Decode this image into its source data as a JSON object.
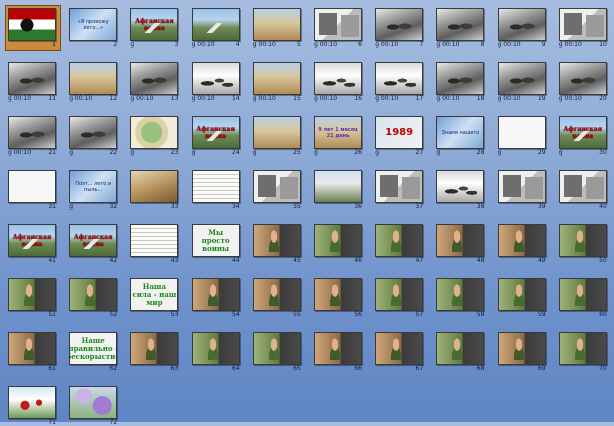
{
  "view": "slide-sorter",
  "selected_slide": 1,
  "slides": [
    {
      "n": "1",
      "timing": "",
      "visual": "flag",
      "text": ""
    },
    {
      "n": "2",
      "timing": "",
      "visual": "blueframe",
      "text": "«Я провожу лето...»"
    },
    {
      "n": "3",
      "timing": "g",
      "visual": "mt",
      "text": "Афганская война"
    },
    {
      "n": "4",
      "timing": "g 00:10",
      "visual": "mt",
      "text": ""
    },
    {
      "n": "5",
      "timing": "g 00:10",
      "visual": "desert",
      "text": ""
    },
    {
      "n": "6",
      "timing": "g 00:10",
      "visual": "collage",
      "text": ""
    },
    {
      "n": "7",
      "timing": "g 00:10",
      "visual": "bw",
      "text": ""
    },
    {
      "n": "8",
      "timing": "g 00:10",
      "visual": "bw",
      "text": ""
    },
    {
      "n": "9",
      "timing": "g 00:10",
      "visual": "bw",
      "text": ""
    },
    {
      "n": "10",
      "timing": "g 00:10",
      "visual": "collage",
      "text": ""
    },
    {
      "n": "11",
      "timing": "g 00:10",
      "visual": "bw",
      "text": ""
    },
    {
      "n": "12",
      "timing": "g 00:10",
      "visual": "desert",
      "text": ""
    },
    {
      "n": "13",
      "timing": "g 00:10",
      "visual": "bw",
      "text": ""
    },
    {
      "n": "14",
      "timing": "g 00:10",
      "visual": "snow",
      "text": ""
    },
    {
      "n": "15",
      "timing": "g 00:10",
      "visual": "desert",
      "text": ""
    },
    {
      "n": "16",
      "timing": "g 00:10",
      "visual": "snow",
      "text": ""
    },
    {
      "n": "17",
      "timing": "g 00:10",
      "visual": "snow",
      "text": ""
    },
    {
      "n": "18",
      "timing": "g 00:10",
      "visual": "bw",
      "text": ""
    },
    {
      "n": "19",
      "timing": "g 00:10",
      "visual": "bw",
      "text": ""
    },
    {
      "n": "20",
      "timing": "g 00:10",
      "visual": "bw",
      "text": ""
    },
    {
      "n": "21",
      "timing": "g 00:10",
      "visual": "bw",
      "text": ""
    },
    {
      "n": "22",
      "timing": "g",
      "visual": "bw",
      "text": ""
    },
    {
      "n": "23",
      "timing": "g",
      "visual": "map",
      "text": ""
    },
    {
      "n": "24",
      "timing": "g",
      "visual": "mt",
      "text": "Афганская война"
    },
    {
      "n": "25",
      "timing": "g",
      "visual": "desert",
      "text": ""
    },
    {
      "n": "26",
      "timing": "g",
      "visual": "desert",
      "text": "9 лет 1 месяц 21 день"
    },
    {
      "n": "27",
      "timing": "g",
      "visual": "colorpatch",
      "text": "1989"
    },
    {
      "n": "28",
      "timing": "g",
      "visual": "blueframe",
      "text": "Знамя нашего"
    },
    {
      "n": "29",
      "timing": "g",
      "visual": "white",
      "text": ""
    },
    {
      "n": "30",
      "timing": "g",
      "visual": "mt",
      "text": "Афганская война"
    },
    {
      "n": "31",
      "timing": "",
      "visual": "white",
      "text": ""
    },
    {
      "n": "32",
      "timing": "g",
      "visual": "blueframe",
      "text": "Поэт...\nлето и пыль..."
    },
    {
      "n": "33",
      "timing": "",
      "visual": "sepia",
      "text": ""
    },
    {
      "n": "34",
      "timing": "",
      "visual": "doc",
      "text": ""
    },
    {
      "n": "35",
      "timing": "",
      "visual": "collage",
      "text": ""
    },
    {
      "n": "36",
      "timing": "",
      "visual": "building",
      "text": ""
    },
    {
      "n": "37",
      "timing": "",
      "visual": "collage",
      "text": ""
    },
    {
      "n": "38",
      "timing": "",
      "visual": "snow",
      "text": ""
    },
    {
      "n": "39",
      "timing": "",
      "visual": "collage",
      "text": ""
    },
    {
      "n": "40",
      "timing": "",
      "visual": "collage",
      "text": ""
    },
    {
      "n": "41",
      "timing": "",
      "visual": "mt",
      "text": "Афганская война"
    },
    {
      "n": "42",
      "timing": "",
      "visual": "mt",
      "text": "Афганская война"
    },
    {
      "n": "43",
      "timing": "",
      "visual": "doc",
      "text": ""
    },
    {
      "n": "44",
      "timing": "",
      "visual": "bigtitle",
      "text": "Мы просто воины"
    },
    {
      "n": "45",
      "timing": "",
      "visual": "portrait",
      "text": ""
    },
    {
      "n": "46",
      "timing": "",
      "visual": "portrait-green",
      "text": ""
    },
    {
      "n": "47",
      "timing": "",
      "visual": "portrait-green",
      "text": ""
    },
    {
      "n": "48",
      "timing": "",
      "visual": "portrait",
      "text": ""
    },
    {
      "n": "49",
      "timing": "",
      "visual": "portrait",
      "text": ""
    },
    {
      "n": "50",
      "timing": "",
      "visual": "portrait-green",
      "text": ""
    },
    {
      "n": "51",
      "timing": "",
      "visual": "portrait-green",
      "text": ""
    },
    {
      "n": "52",
      "timing": "",
      "visual": "portrait-green",
      "text": ""
    },
    {
      "n": "53",
      "timing": "",
      "visual": "bigtitle",
      "text": "Наша сила - наш мир"
    },
    {
      "n": "54",
      "timing": "",
      "visual": "portrait",
      "text": ""
    },
    {
      "n": "55",
      "timing": "",
      "visual": "portrait",
      "text": ""
    },
    {
      "n": "56",
      "timing": "",
      "visual": "portrait",
      "text": ""
    },
    {
      "n": "57",
      "timing": "",
      "visual": "portrait-green",
      "text": ""
    },
    {
      "n": "58",
      "timing": "",
      "visual": "portrait-green",
      "text": ""
    },
    {
      "n": "59",
      "timing": "",
      "visual": "portrait-green",
      "text": ""
    },
    {
      "n": "60",
      "timing": "",
      "visual": "portrait-green",
      "text": ""
    },
    {
      "n": "61",
      "timing": "",
      "visual": "portrait",
      "text": ""
    },
    {
      "n": "62",
      "timing": "",
      "visual": "bigtitle",
      "text": "Наше правильно - бескорыстие"
    },
    {
      "n": "63",
      "timing": "",
      "visual": "portrait",
      "text": ""
    },
    {
      "n": "64",
      "timing": "",
      "visual": "portrait-green",
      "text": ""
    },
    {
      "n": "65",
      "timing": "",
      "visual": "portrait-green",
      "text": ""
    },
    {
      "n": "66",
      "timing": "",
      "visual": "portrait",
      "text": ""
    },
    {
      "n": "67",
      "timing": "",
      "visual": "portrait",
      "text": ""
    },
    {
      "n": "68",
      "timing": "",
      "visual": "portrait-green",
      "text": ""
    },
    {
      "n": "69",
      "timing": "",
      "visual": "portrait",
      "text": ""
    },
    {
      "n": "70",
      "timing": "",
      "visual": "portrait-green",
      "text": ""
    },
    {
      "n": "71",
      "timing": "",
      "visual": "poppy",
      "text": ""
    },
    {
      "n": "72",
      "timing": "",
      "visual": "lilac",
      "text": ""
    }
  ]
}
